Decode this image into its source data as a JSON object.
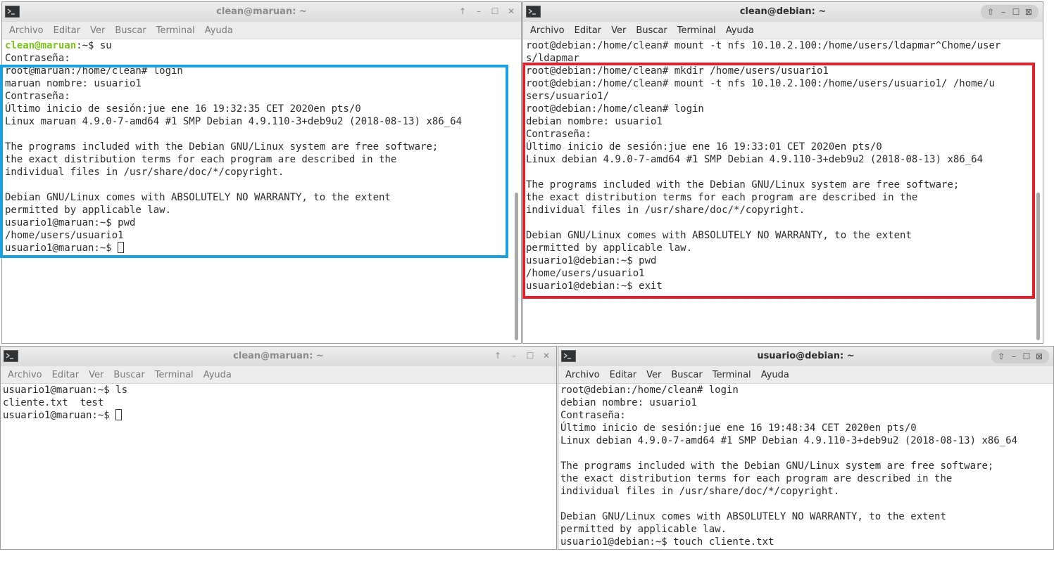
{
  "windows": {
    "tl": {
      "title": "clean@maruan: ~",
      "menu": [
        "Archivo",
        "Editar",
        "Ver",
        "Buscar",
        "Terminal",
        "Ayuda"
      ],
      "lines": [
        {
          "user": "clean@maruan",
          "rest": ":~$ su"
        },
        "Contraseña:",
        "root@maruan:/home/clean# login",
        "maruan nombre: usuario1",
        "Contraseña:",
        "Último inicio de sesión:jue ene 16 19:32:35 CET 2020en pts/0",
        "Linux maruan 4.9.0-7-amd64 #1 SMP Debian 4.9.110-3+deb9u2 (2018-08-13) x86_64",
        "",
        "The programs included with the Debian GNU/Linux system are free software;",
        "the exact distribution terms for each program are described in the",
        "individual files in /usr/share/doc/*/copyright.",
        "",
        "Debian GNU/Linux comes with ABSOLUTELY NO WARRANTY, to the extent",
        "permitted by applicable law.",
        "usuario1@maruan:~$ pwd",
        "/home/users/usuario1",
        {
          "text": "usuario1@maruan:~$ ",
          "cursor": true
        }
      ]
    },
    "tr": {
      "title": "clean@debian: ~",
      "menu": [
        "Archivo",
        "Editar",
        "Ver",
        "Buscar",
        "Terminal",
        "Ayuda"
      ],
      "lines": [
        "root@debian:/home/clean# mount -t nfs 10.10.2.100:/home/users/ldapmar^Chome/user",
        "s/ldapmar",
        "root@debian:/home/clean# mkdir /home/users/usuario1",
        "root@debian:/home/clean# mount -t nfs 10.10.2.100:/home/users/usuario1/ /home/u",
        "sers/usuario1/",
        "root@debian:/home/clean# login",
        "debian nombre: usuario1",
        "Contraseña:",
        "Último inicio de sesión:jue ene 16 19:33:01 CET 2020en pts/0",
        "Linux debian 4.9.0-7-amd64 #1 SMP Debian 4.9.110-3+deb9u2 (2018-08-13) x86_64",
        "",
        "The programs included with the Debian GNU/Linux system are free software;",
        "the exact distribution terms for each program are described in the",
        "individual files in /usr/share/doc/*/copyright.",
        "",
        "Debian GNU/Linux comes with ABSOLUTELY NO WARRANTY, to the extent",
        "permitted by applicable law.",
        "usuario1@debian:~$ pwd",
        "/home/users/usuario1",
        "usuario1@debian:~$ exit"
      ]
    },
    "bl": {
      "title": "clean@maruan: ~",
      "menu": [
        "Archivo",
        "Editar",
        "Ver",
        "Buscar",
        "Terminal",
        "Ayuda"
      ],
      "lines": [
        "usuario1@maruan:~$ ls",
        "cliente.txt  test",
        {
          "text": "usuario1@maruan:~$ ",
          "cursor": true
        }
      ]
    },
    "br": {
      "title": "usuario@debian: ~",
      "menu": [
        "Archivo",
        "Editar",
        "Ver",
        "Buscar",
        "Terminal",
        "Ayuda"
      ],
      "lines": [
        "root@debian:/home/clean# login",
        "debian nombre: usuario1",
        "Contraseña:",
        "Último inicio de sesión:jue ene 16 19:48:34 CET 2020en pts/0",
        "Linux debian 4.9.0-7-amd64 #1 SMP Debian 4.9.110-3+deb9u2 (2018-08-13) x86_64",
        "",
        "The programs included with the Debian GNU/Linux system are free software;",
        "the exact distribution terms for each program are described in the",
        "individual files in /usr/share/doc/*/copyright.",
        "",
        "Debian GNU/Linux comes with ABSOLUTELY NO WARRANTY, to the extent",
        "permitted by applicable law.",
        "usuario1@debian:~$ touch cliente.txt"
      ]
    }
  },
  "highlights": {
    "blue": "#1a9fe0",
    "red": "#e3202b"
  }
}
